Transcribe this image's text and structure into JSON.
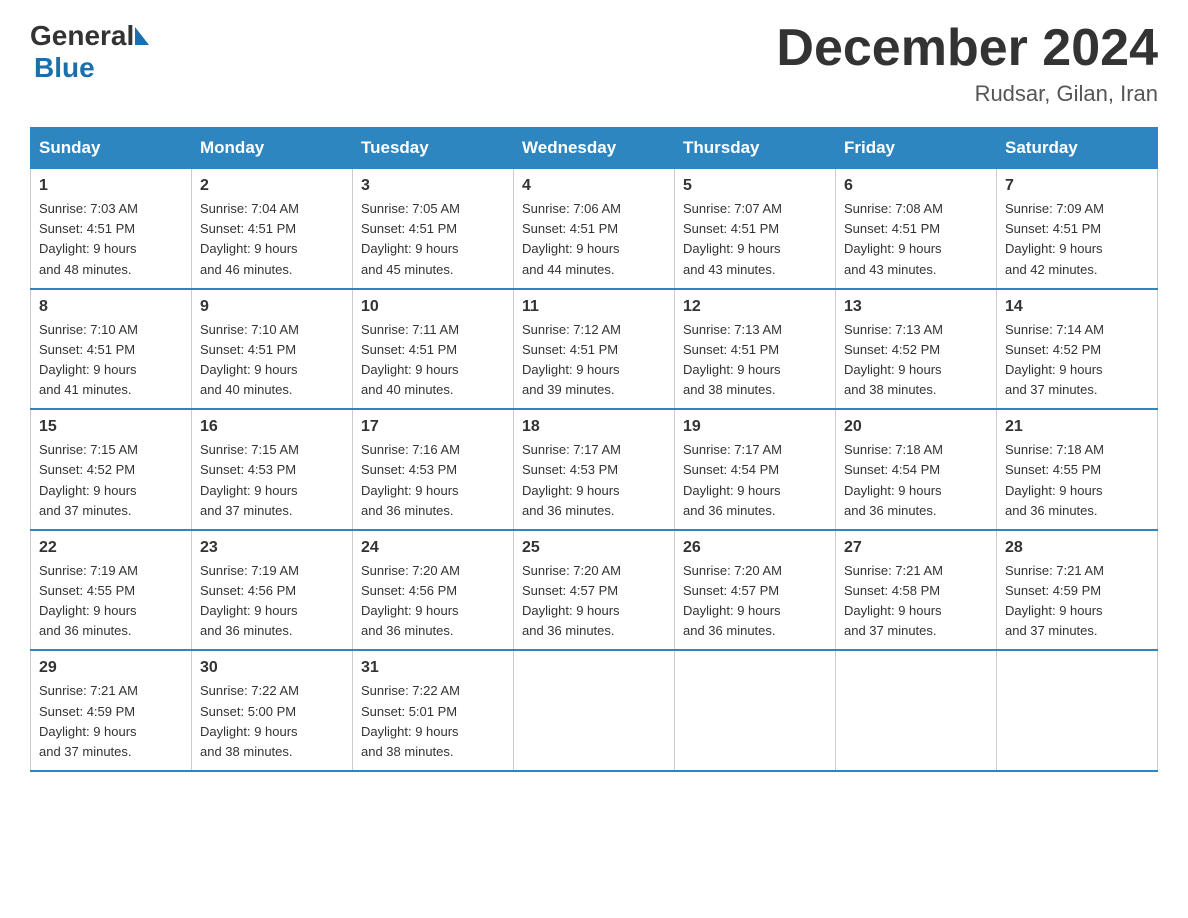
{
  "header": {
    "logo_general": "General",
    "logo_blue": "Blue",
    "month_title": "December 2024",
    "subtitle": "Rudsar, Gilan, Iran"
  },
  "days_of_week": [
    "Sunday",
    "Monday",
    "Tuesday",
    "Wednesday",
    "Thursday",
    "Friday",
    "Saturday"
  ],
  "weeks": [
    [
      {
        "day": "1",
        "sunrise": "7:03 AM",
        "sunset": "4:51 PM",
        "daylight": "9 hours and 48 minutes."
      },
      {
        "day": "2",
        "sunrise": "7:04 AM",
        "sunset": "4:51 PM",
        "daylight": "9 hours and 46 minutes."
      },
      {
        "day": "3",
        "sunrise": "7:05 AM",
        "sunset": "4:51 PM",
        "daylight": "9 hours and 45 minutes."
      },
      {
        "day": "4",
        "sunrise": "7:06 AM",
        "sunset": "4:51 PM",
        "daylight": "9 hours and 44 minutes."
      },
      {
        "day": "5",
        "sunrise": "7:07 AM",
        "sunset": "4:51 PM",
        "daylight": "9 hours and 43 minutes."
      },
      {
        "day": "6",
        "sunrise": "7:08 AM",
        "sunset": "4:51 PM",
        "daylight": "9 hours and 43 minutes."
      },
      {
        "day": "7",
        "sunrise": "7:09 AM",
        "sunset": "4:51 PM",
        "daylight": "9 hours and 42 minutes."
      }
    ],
    [
      {
        "day": "8",
        "sunrise": "7:10 AM",
        "sunset": "4:51 PM",
        "daylight": "9 hours and 41 minutes."
      },
      {
        "day": "9",
        "sunrise": "7:10 AM",
        "sunset": "4:51 PM",
        "daylight": "9 hours and 40 minutes."
      },
      {
        "day": "10",
        "sunrise": "7:11 AM",
        "sunset": "4:51 PM",
        "daylight": "9 hours and 40 minutes."
      },
      {
        "day": "11",
        "sunrise": "7:12 AM",
        "sunset": "4:51 PM",
        "daylight": "9 hours and 39 minutes."
      },
      {
        "day": "12",
        "sunrise": "7:13 AM",
        "sunset": "4:51 PM",
        "daylight": "9 hours and 38 minutes."
      },
      {
        "day": "13",
        "sunrise": "7:13 AM",
        "sunset": "4:52 PM",
        "daylight": "9 hours and 38 minutes."
      },
      {
        "day": "14",
        "sunrise": "7:14 AM",
        "sunset": "4:52 PM",
        "daylight": "9 hours and 37 minutes."
      }
    ],
    [
      {
        "day": "15",
        "sunrise": "7:15 AM",
        "sunset": "4:52 PM",
        "daylight": "9 hours and 37 minutes."
      },
      {
        "day": "16",
        "sunrise": "7:15 AM",
        "sunset": "4:53 PM",
        "daylight": "9 hours and 37 minutes."
      },
      {
        "day": "17",
        "sunrise": "7:16 AM",
        "sunset": "4:53 PM",
        "daylight": "9 hours and 36 minutes."
      },
      {
        "day": "18",
        "sunrise": "7:17 AM",
        "sunset": "4:53 PM",
        "daylight": "9 hours and 36 minutes."
      },
      {
        "day": "19",
        "sunrise": "7:17 AM",
        "sunset": "4:54 PM",
        "daylight": "9 hours and 36 minutes."
      },
      {
        "day": "20",
        "sunrise": "7:18 AM",
        "sunset": "4:54 PM",
        "daylight": "9 hours and 36 minutes."
      },
      {
        "day": "21",
        "sunrise": "7:18 AM",
        "sunset": "4:55 PM",
        "daylight": "9 hours and 36 minutes."
      }
    ],
    [
      {
        "day": "22",
        "sunrise": "7:19 AM",
        "sunset": "4:55 PM",
        "daylight": "9 hours and 36 minutes."
      },
      {
        "day": "23",
        "sunrise": "7:19 AM",
        "sunset": "4:56 PM",
        "daylight": "9 hours and 36 minutes."
      },
      {
        "day": "24",
        "sunrise": "7:20 AM",
        "sunset": "4:56 PM",
        "daylight": "9 hours and 36 minutes."
      },
      {
        "day": "25",
        "sunrise": "7:20 AM",
        "sunset": "4:57 PM",
        "daylight": "9 hours and 36 minutes."
      },
      {
        "day": "26",
        "sunrise": "7:20 AM",
        "sunset": "4:57 PM",
        "daylight": "9 hours and 36 minutes."
      },
      {
        "day": "27",
        "sunrise": "7:21 AM",
        "sunset": "4:58 PM",
        "daylight": "9 hours and 37 minutes."
      },
      {
        "day": "28",
        "sunrise": "7:21 AM",
        "sunset": "4:59 PM",
        "daylight": "9 hours and 37 minutes."
      }
    ],
    [
      {
        "day": "29",
        "sunrise": "7:21 AM",
        "sunset": "4:59 PM",
        "daylight": "9 hours and 37 minutes."
      },
      {
        "day": "30",
        "sunrise": "7:22 AM",
        "sunset": "5:00 PM",
        "daylight": "9 hours and 38 minutes."
      },
      {
        "day": "31",
        "sunrise": "7:22 AM",
        "sunset": "5:01 PM",
        "daylight": "9 hours and 38 minutes."
      },
      null,
      null,
      null,
      null
    ]
  ],
  "labels": {
    "sunrise_prefix": "Sunrise: ",
    "sunset_prefix": "Sunset: ",
    "daylight_prefix": "Daylight: "
  }
}
